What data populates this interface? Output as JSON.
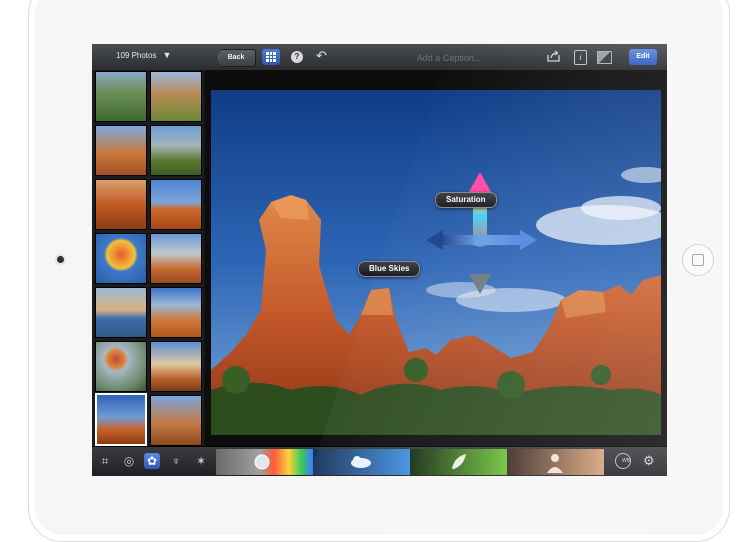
{
  "topbar": {
    "photo_count_label": "109 Photos",
    "back_label": "Back",
    "caption_placeholder": "Add a Caption...",
    "edit_label": "Edit"
  },
  "brush_labels": {
    "saturation": "Saturation",
    "blue_skies": "Blue Skies"
  },
  "wb_label": "WB",
  "colors": {
    "accent_blue": "#2e5bbd",
    "toolbar_dark": "#2b2d31",
    "sky_blue": "#3b6fbf",
    "rock_orange": "#c85a2a"
  },
  "icons": [
    "crop-icon",
    "exposure-icon",
    "color-palette-icon",
    "brushes-icon",
    "effects-icon",
    "white-balance-icon",
    "settings-icon",
    "share-icon",
    "info-icon",
    "compare-icon",
    "help-icon",
    "undo-icon",
    "grid-icon"
  ]
}
